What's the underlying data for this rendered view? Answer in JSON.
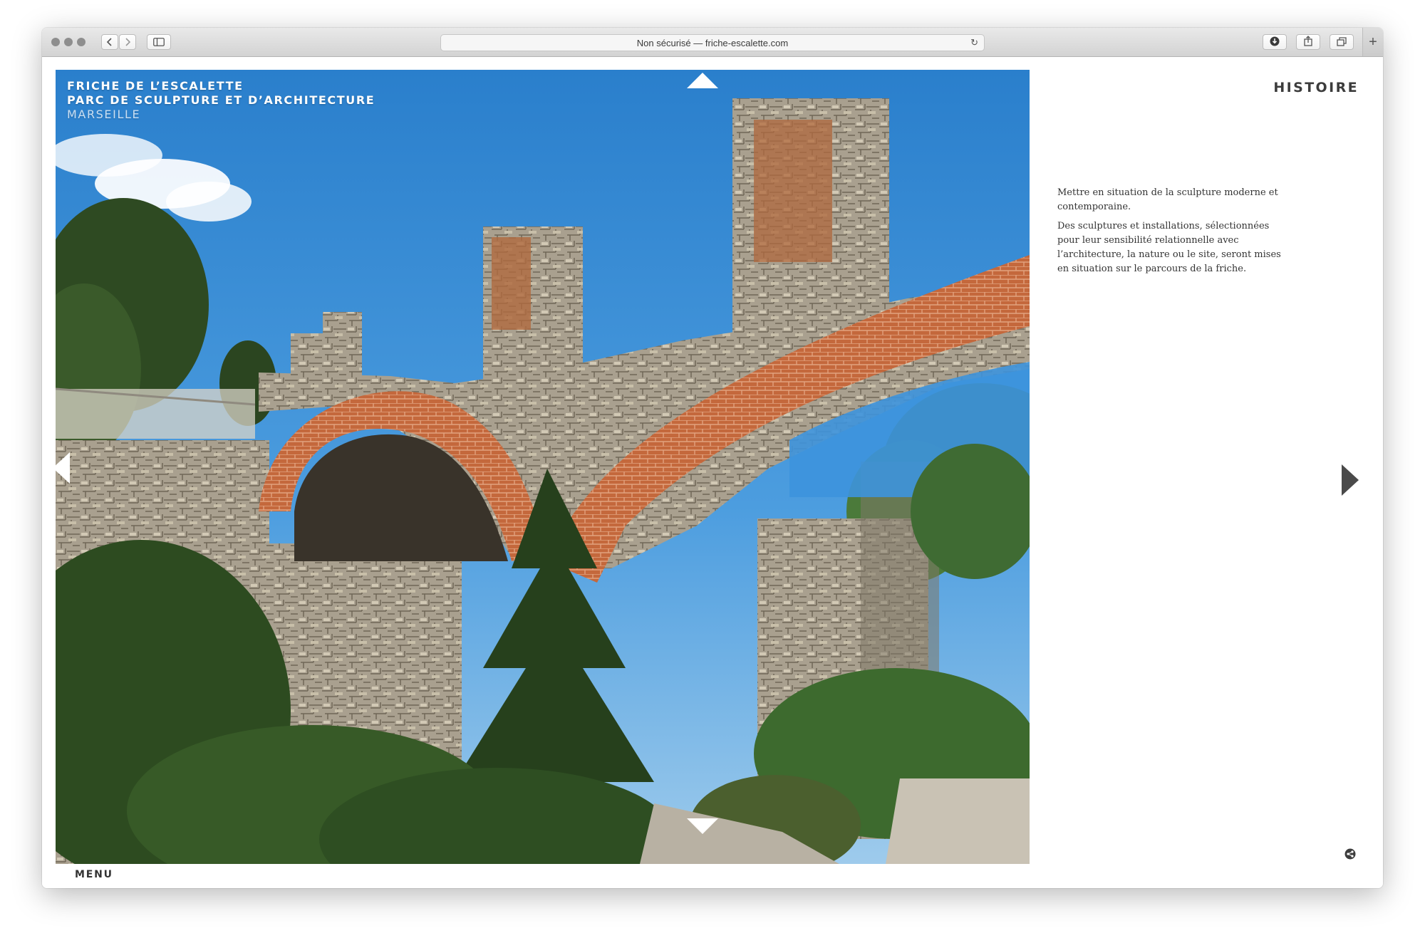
{
  "browser": {
    "address": "Non sécurisé — friche-escalette.com",
    "buttons": {
      "back": "‹",
      "forward": "›",
      "new_tab": "+",
      "reload": "↻"
    },
    "icons": [
      "sidebar-icon",
      "download-icon",
      "share-icon",
      "tabs-icon"
    ]
  },
  "site": {
    "title_line1": "FRICHE DE L’ESCALETTE",
    "title_line2": "PARC DE SCULPTURE ET D’ARCHITECTURE",
    "title_line3": "MARSEILLE"
  },
  "nav": {
    "menu": "MENU",
    "section": "HISTOIRE"
  },
  "content": {
    "paragraph1": "Mettre en situation de la sculpture moderne et contemporaine.",
    "paragraph2": "Des sculptures et installations, sélectionnées pour leur sensibilité relationnelle avec l’architecture, la nature ou le site, seront mises en situation sur le parcours de la friche."
  },
  "colors": {
    "sky": "#2a86d1",
    "brick": "#c0653a",
    "stone": "#a59c8c",
    "foliage": "#2f4a22",
    "text": "#333333"
  }
}
